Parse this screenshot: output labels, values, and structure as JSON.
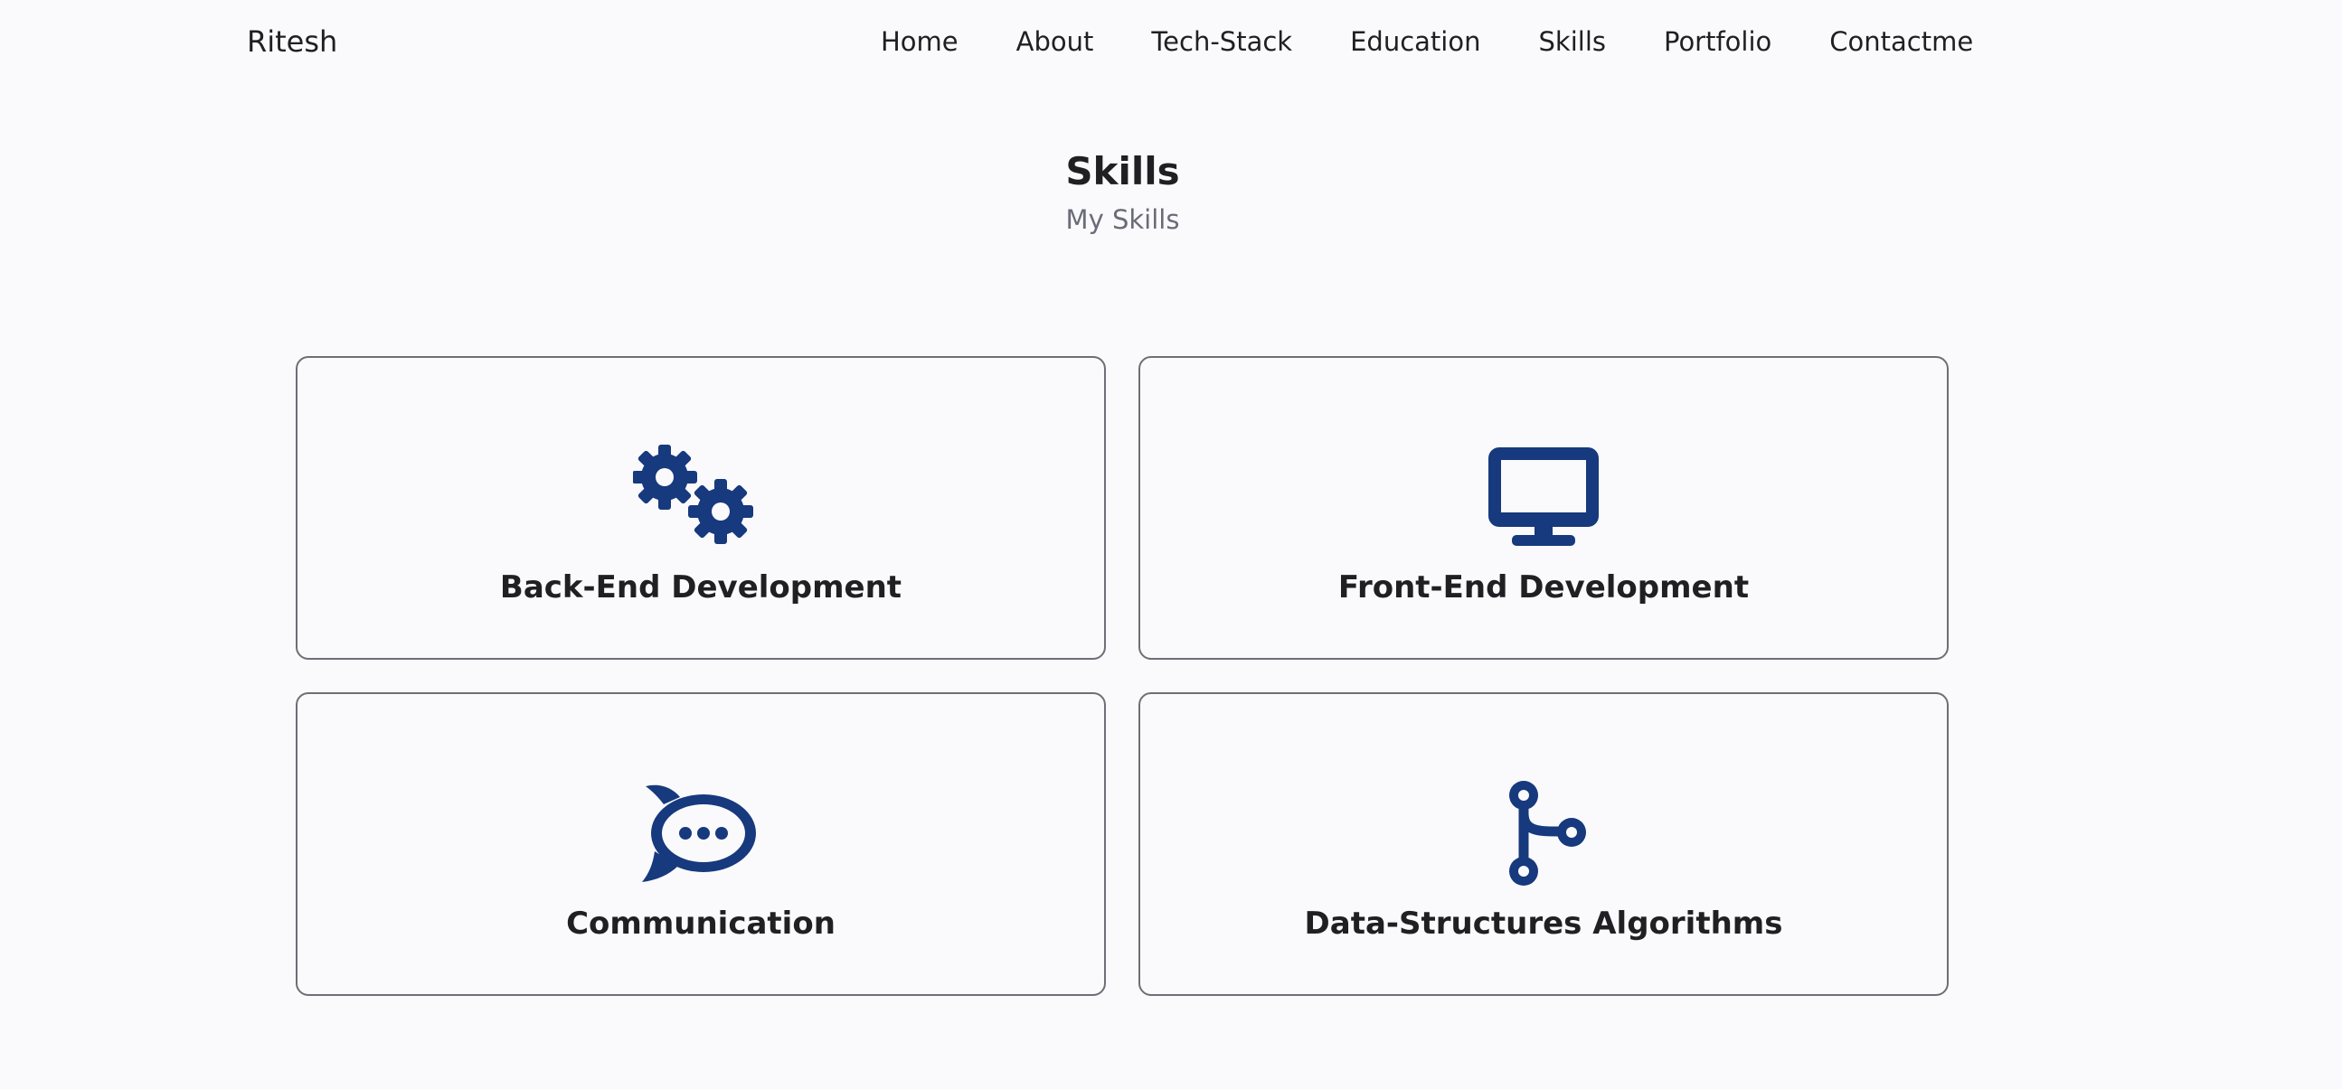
{
  "nav": {
    "brand": "Ritesh",
    "links": [
      "Home",
      "About",
      "Tech-Stack",
      "Education",
      "Skills",
      "Portfolio",
      "Contactme"
    ]
  },
  "section": {
    "title": "Skills",
    "subtitle": "My Skills"
  },
  "skills": [
    {
      "title": "Back-End Development",
      "icon": "gears-icon"
    },
    {
      "title": "Front-End Development",
      "icon": "desktop-monitor-icon"
    },
    {
      "title": "Communication",
      "icon": "chat-bubble-icon"
    },
    {
      "title": "Data-Structures Algorithms",
      "icon": "git-branch-icon"
    }
  ],
  "colors": {
    "icon_accent": "#17397d",
    "background": "#fafafc",
    "text": "#1f1f24",
    "muted_text": "#6b6b78",
    "card_border": "#6e6e78"
  }
}
